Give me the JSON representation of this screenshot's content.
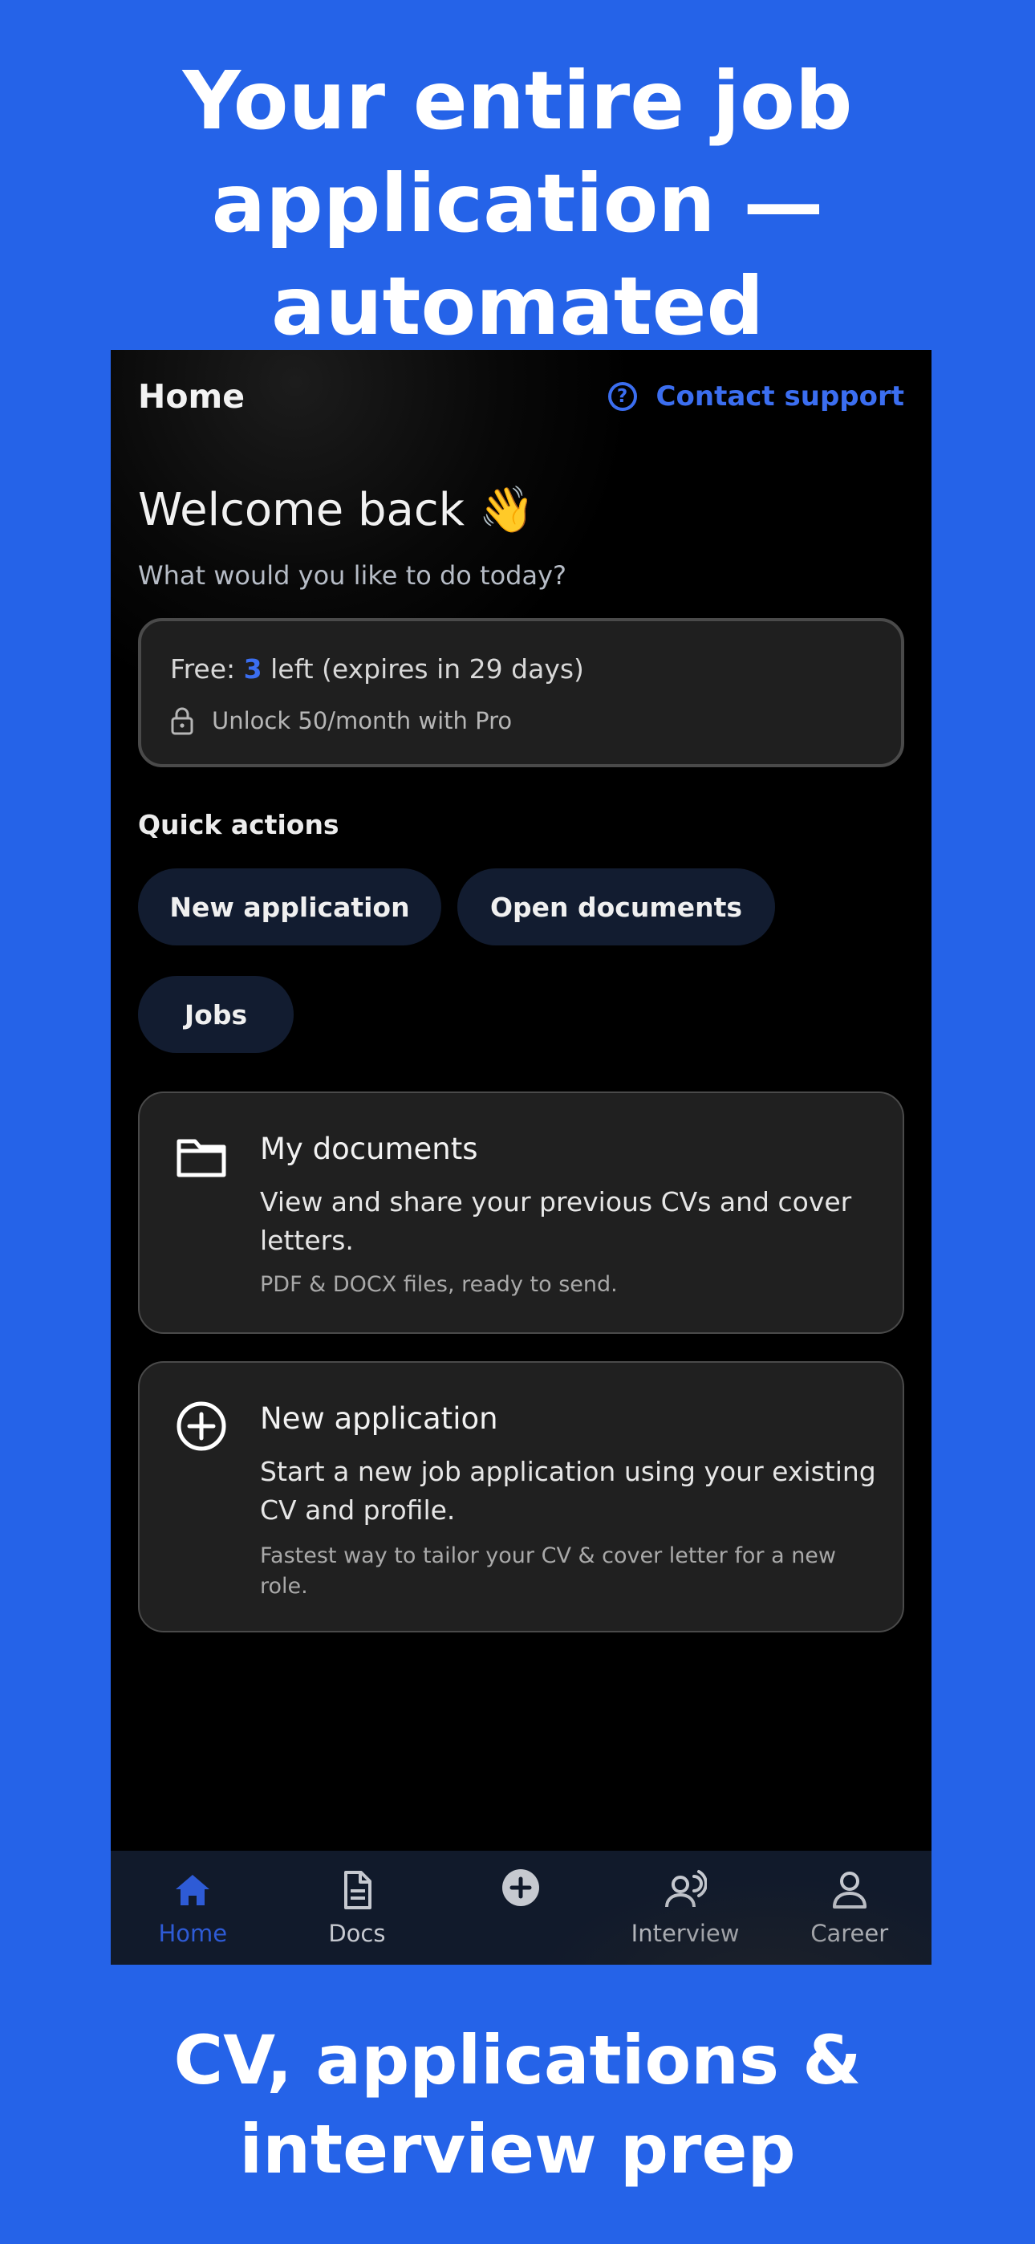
{
  "promo": {
    "headline_line1": "Your entire job",
    "headline_line2": "application — automated",
    "footer_line1": "CV, applications &",
    "footer_line2": "interview prep"
  },
  "header": {
    "title": "Home",
    "support_label": "Contact support",
    "support_icon": "help-circle-icon"
  },
  "welcome": {
    "title": "Welcome back 👋",
    "subtitle": "What would you like to do today?"
  },
  "plan": {
    "free_prefix": "Free: ",
    "free_count": "3",
    "free_suffix": " left (expires in 29 days)",
    "pro_text": "Unlock 50/month with Pro",
    "pro_icon": "lock-icon"
  },
  "quick_actions": {
    "label": "Quick actions",
    "items": [
      {
        "label": "New application"
      },
      {
        "label": "Open documents"
      },
      {
        "label": "Jobs"
      }
    ]
  },
  "cards": [
    {
      "icon": "folder-icon",
      "title": "My documents",
      "description": "View and share your previous CVs and cover letters.",
      "note": "PDF & DOCX files, ready to send."
    },
    {
      "icon": "plus-circle-icon",
      "title": "New application",
      "description": "Start a new job application using your existing CV and profile.",
      "note": "Fastest way to tailor your CV & cover letter for a new role."
    }
  ],
  "tabs": [
    {
      "label": "Home",
      "icon": "home-icon",
      "active": true
    },
    {
      "label": "Docs",
      "icon": "document-icon",
      "active": false
    },
    {
      "label": "",
      "icon": "add-circle-icon",
      "active": false
    },
    {
      "label": "Interview",
      "icon": "interview-icon",
      "active": false
    },
    {
      "label": "Career",
      "icon": "person-icon",
      "active": false
    }
  ],
  "colors": {
    "background": "#2563E8",
    "accent": "#3B6EF0",
    "card": "#202020",
    "tabbar": "#111A2B"
  }
}
